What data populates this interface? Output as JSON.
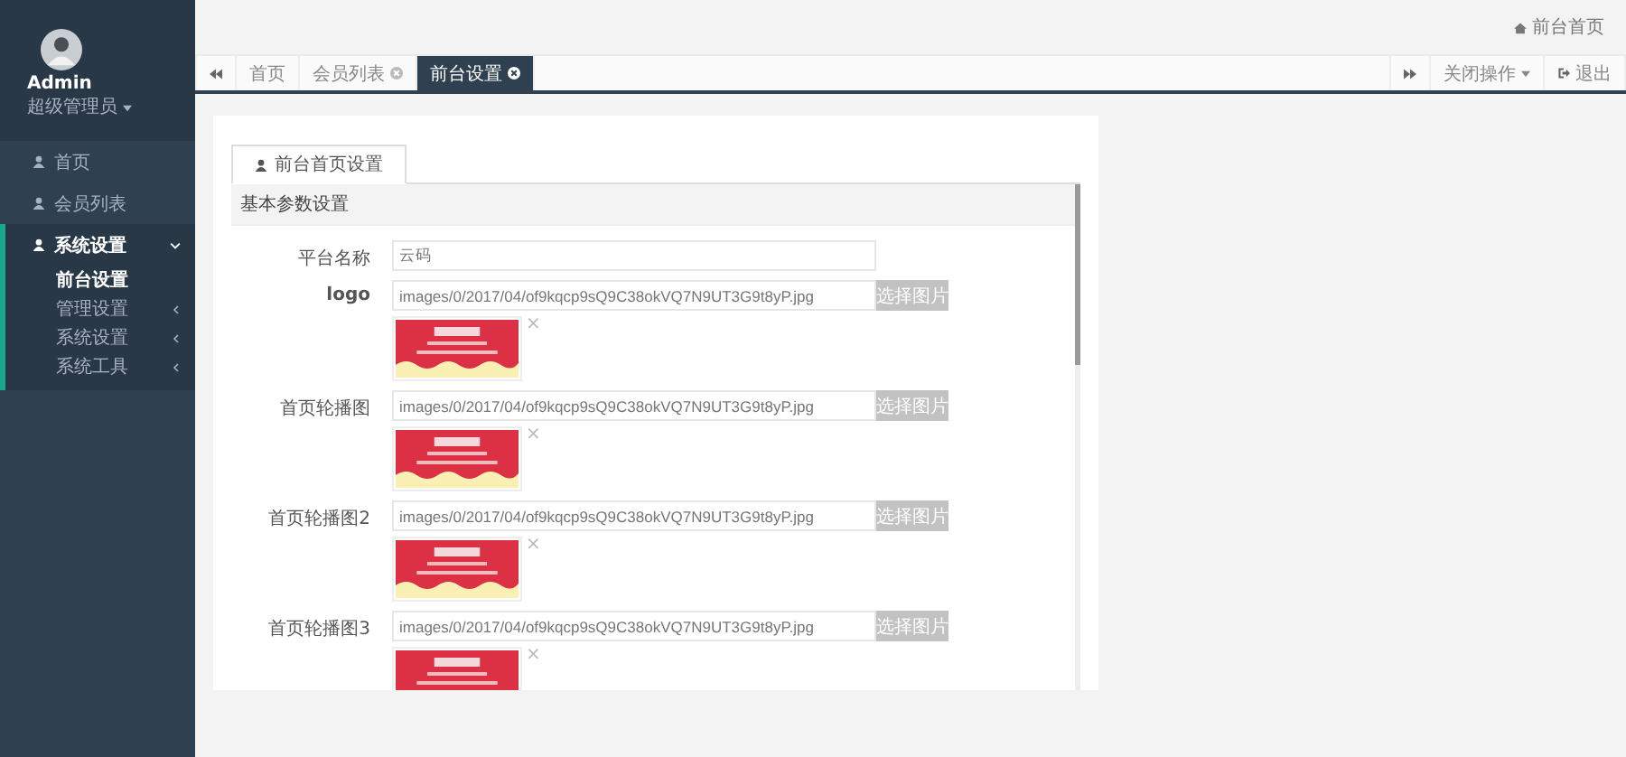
{
  "sidebar": {
    "user": {
      "name": "Admin",
      "role": "超级管理员"
    },
    "items": [
      {
        "label": "首页",
        "selected": false
      },
      {
        "label": "会员列表",
        "selected": false
      },
      {
        "label": "系统设置",
        "selected": true,
        "expanded": true,
        "children": [
          {
            "label": "前台设置",
            "selected": true
          },
          {
            "label": "管理设置",
            "selected": false
          },
          {
            "label": "系统设置",
            "selected": false
          },
          {
            "label": "系统工具",
            "selected": false
          }
        ]
      }
    ]
  },
  "topbar": {
    "home_link": "前台首页"
  },
  "tabs": [
    {
      "label": "首页",
      "selected": false,
      "closable": false
    },
    {
      "label": "会员列表",
      "selected": false,
      "closable": true
    },
    {
      "label": "前台设置",
      "selected": true,
      "closable": true
    }
  ],
  "tab_actions": {
    "close_menu": "关闭操作",
    "logout": "退出"
  },
  "card": {
    "tab": "前台首页设置",
    "section": "基本参数设置",
    "fields": [
      {
        "kind": "text",
        "label": "平台名称",
        "value": "云码"
      },
      {
        "label": "logo",
        "value": "images/0/2017/04/of9kqcp9sQ9C38okVQ7N9UT3G9t8yP.jpg",
        "button": "选择图片",
        "remove": "×"
      },
      {
        "label": "首页轮播图",
        "value": "images/0/2017/04/of9kqcp9sQ9C38okVQ7N9UT3G9t8yP.jpg",
        "button": "选择图片",
        "remove": "×"
      },
      {
        "label": "首页轮播图2",
        "value": "images/0/2017/04/of9kqcp9sQ9C38okVQ7N9UT3G9t8yP.jpg",
        "button": "选择图片",
        "remove": "×"
      },
      {
        "label": "首页轮播图3",
        "value": "images/0/2017/04/of9kqcp9sQ9C38okVQ7N9UT3G9t8yP.jpg",
        "button": "选择图片",
        "remove": "×"
      }
    ]
  }
}
